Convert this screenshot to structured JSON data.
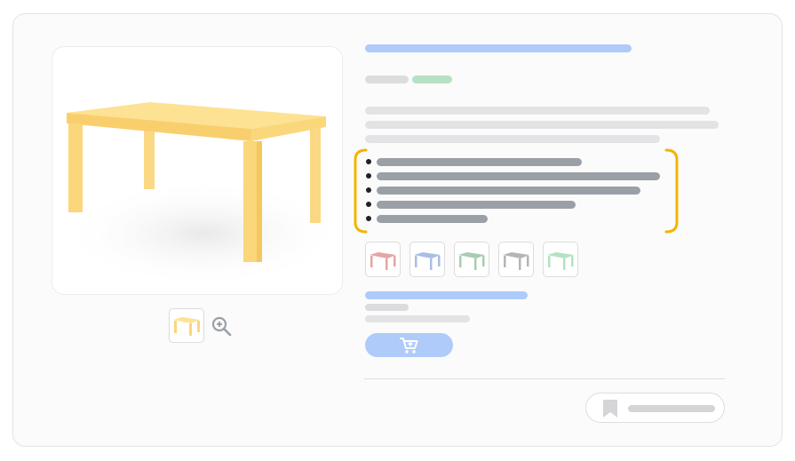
{
  "colors": {
    "accent_blue": "#aecbfa",
    "badge_green": "#b7e1c4",
    "text_gray": "#9aa0a6",
    "placeholder_gray": "#e3e3e6",
    "highlight_bracket": "#f4b400",
    "product_wood": "#fde293"
  },
  "product": {
    "image_icon": "table-icon",
    "thumbnail_icon": "table-icon",
    "zoom_icon": "zoom-in-icon"
  },
  "variants": [
    {
      "color": "#e6a5a5"
    },
    {
      "color": "#a9bde6"
    },
    {
      "color": "#a8cdb0"
    },
    {
      "color": "#b5b5b5"
    },
    {
      "color": "#b3e3bf"
    }
  ],
  "actions": {
    "cart_icon": "shopping-cart-icon",
    "save_icon": "bookmark-icon"
  }
}
